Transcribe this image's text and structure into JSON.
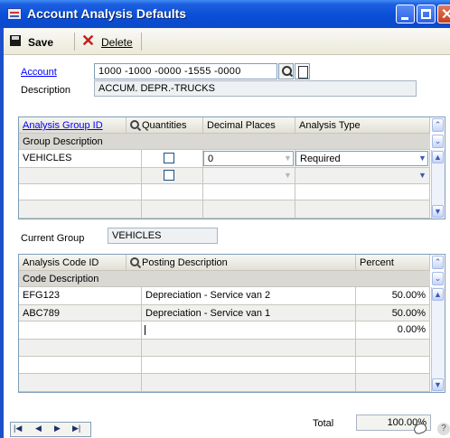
{
  "window": {
    "title": "Account Analysis Defaults"
  },
  "toolbar": {
    "save_label": "Save",
    "delete_label": "Delete"
  },
  "account": {
    "label": "Account",
    "value": "1000 -1000 -0000 -1555 -0000",
    "description_label": "Description",
    "description_value": "ACCUM. DEPR.-TRUCKS"
  },
  "group_grid": {
    "headers": {
      "group_id": "Analysis Group ID",
      "quantities": "Quantities",
      "decimal_places": "Decimal Places",
      "analysis_type": "Analysis Type",
      "group_description": "Group Description"
    },
    "rows": [
      {
        "group_id": "VEHICLES",
        "quantities": false,
        "decimal_places": "0",
        "analysis_type": "Required"
      },
      {
        "group_id": "",
        "quantities": false,
        "decimal_places": "",
        "analysis_type": ""
      }
    ]
  },
  "current_group": {
    "label": "Current Group",
    "value": "VEHICLES"
  },
  "code_grid": {
    "headers": {
      "code_id": "Analysis Code ID",
      "posting_description": "Posting Description",
      "percent": "Percent",
      "code_description": "Code Description"
    },
    "rows": [
      {
        "code_id": "EFG123",
        "posting_description": "Depreciation - Service van 2",
        "percent": "50.00%"
      },
      {
        "code_id": "ABC789",
        "posting_description": "Depreciation - Service van 1",
        "percent": "50.00%"
      },
      {
        "code_id": "",
        "posting_description": "",
        "percent": "0.00%"
      }
    ],
    "total_label": "Total",
    "total_value": "100.00%"
  },
  "icons": {
    "app": "window-icon",
    "save": "save-icon",
    "delete": "delete-x-icon",
    "lookup": "magnifier-icon",
    "new": "new-document-icon",
    "note": "note-icon",
    "help": "help-icon"
  }
}
